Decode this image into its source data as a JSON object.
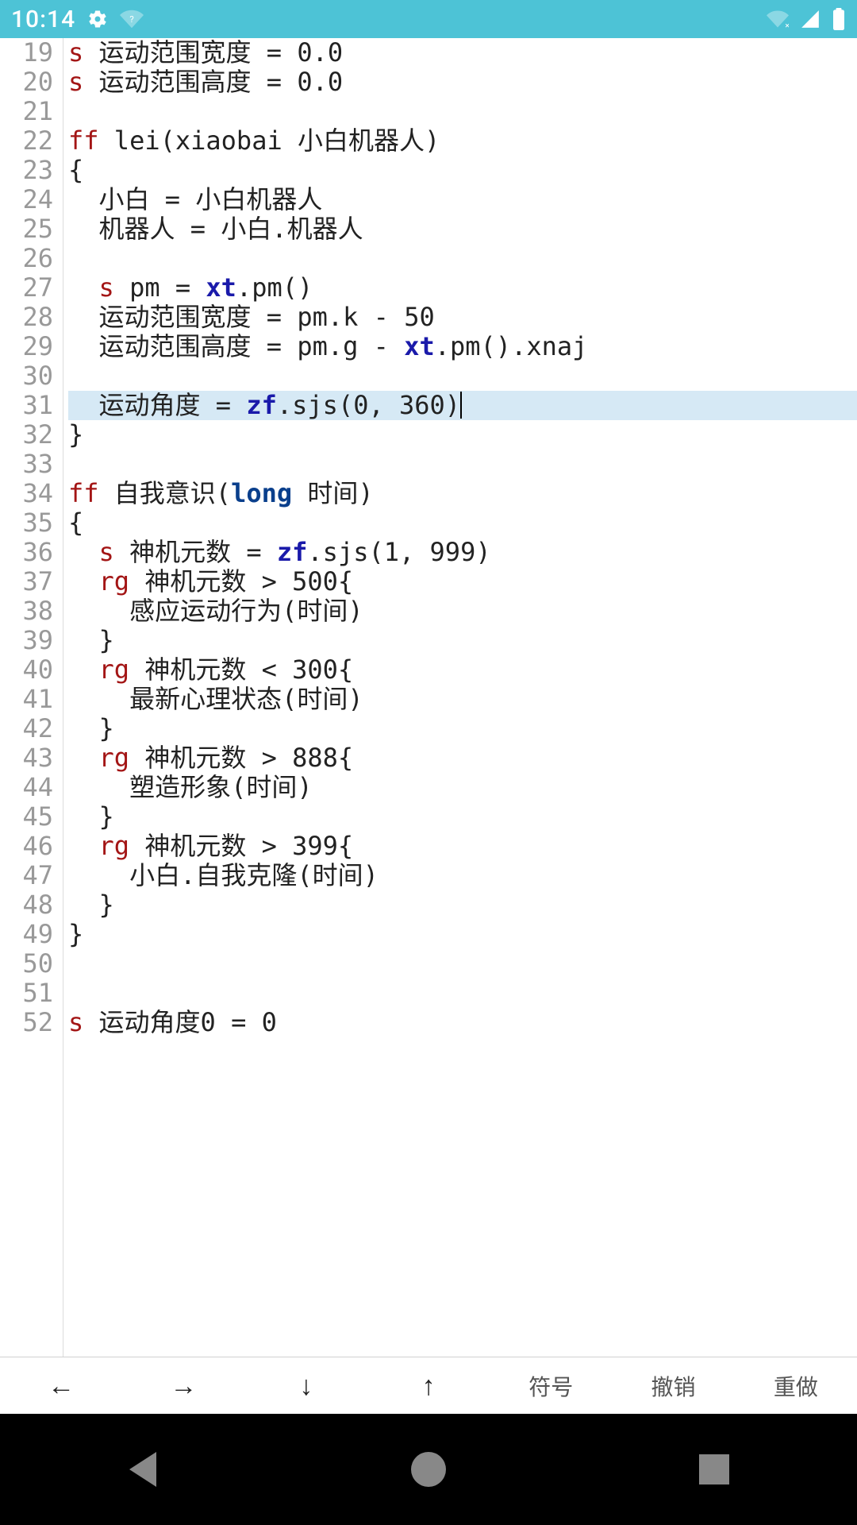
{
  "status": {
    "time": "10:14"
  },
  "toolbar": {
    "left": "←",
    "right": "→",
    "down": "↓",
    "up": "↑",
    "symbol": "符号",
    "undo": "撤销",
    "redo": "重做"
  },
  "code": {
    "first_line_no": 19,
    "highlighted_line_no": 31,
    "lines": [
      {
        "n": 19,
        "tokens": [
          [
            "kw",
            "s"
          ],
          [
            "txt",
            " 运动范围宽度 = 0.0"
          ]
        ]
      },
      {
        "n": 20,
        "tokens": [
          [
            "kw",
            "s"
          ],
          [
            "txt",
            " 运动范围高度 = 0.0"
          ]
        ]
      },
      {
        "n": 21,
        "tokens": []
      },
      {
        "n": 22,
        "tokens": [
          [
            "kw",
            "ff"
          ],
          [
            "txt",
            " lei(xiaobai 小白机器人)"
          ]
        ]
      },
      {
        "n": 23,
        "tokens": [
          [
            "txt",
            "{"
          ]
        ]
      },
      {
        "n": 24,
        "tokens": [
          [
            "txt",
            "  小白 = 小白机器人"
          ]
        ]
      },
      {
        "n": 25,
        "tokens": [
          [
            "txt",
            "  机器人 = 小白.机器人"
          ]
        ]
      },
      {
        "n": 26,
        "tokens": []
      },
      {
        "n": 27,
        "tokens": [
          [
            "txt",
            "  "
          ],
          [
            "kw",
            "s"
          ],
          [
            "txt",
            " pm = "
          ],
          [
            "fn",
            "xt"
          ],
          [
            "txt",
            ".pm()"
          ]
        ]
      },
      {
        "n": 28,
        "tokens": [
          [
            "txt",
            "  运动范围宽度 = pm.k - 50"
          ]
        ]
      },
      {
        "n": 29,
        "tokens": [
          [
            "txt",
            "  运动范围高度 = pm.g - "
          ],
          [
            "fn",
            "xt"
          ],
          [
            "txt",
            ".pm().xnaj"
          ]
        ]
      },
      {
        "n": 30,
        "tokens": []
      },
      {
        "n": 31,
        "tokens": [
          [
            "txt",
            "  运动角度 = "
          ],
          [
            "fn",
            "zf"
          ],
          [
            "txt",
            ".sjs(0, 360)"
          ]
        ]
      },
      {
        "n": 32,
        "tokens": [
          [
            "txt",
            "}"
          ]
        ]
      },
      {
        "n": 33,
        "tokens": []
      },
      {
        "n": 34,
        "tokens": [
          [
            "kw",
            "ff"
          ],
          [
            "txt",
            " 自我意识("
          ],
          [
            "kw2",
            "long"
          ],
          [
            "txt",
            " 时间)"
          ]
        ]
      },
      {
        "n": 35,
        "tokens": [
          [
            "txt",
            "{"
          ]
        ]
      },
      {
        "n": 36,
        "tokens": [
          [
            "txt",
            "  "
          ],
          [
            "kw",
            "s"
          ],
          [
            "txt",
            " 神机元数 = "
          ],
          [
            "fn",
            "zf"
          ],
          [
            "txt",
            ".sjs(1, 999)"
          ]
        ]
      },
      {
        "n": 37,
        "tokens": [
          [
            "txt",
            "  "
          ],
          [
            "kw",
            "rg"
          ],
          [
            "txt",
            " 神机元数 > 500{"
          ]
        ]
      },
      {
        "n": 38,
        "tokens": [
          [
            "txt",
            "    感应运动行为(时间)"
          ]
        ]
      },
      {
        "n": 39,
        "tokens": [
          [
            "txt",
            "  }"
          ]
        ]
      },
      {
        "n": 40,
        "tokens": [
          [
            "txt",
            "  "
          ],
          [
            "kw",
            "rg"
          ],
          [
            "txt",
            " 神机元数 < 300{"
          ]
        ]
      },
      {
        "n": 41,
        "tokens": [
          [
            "txt",
            "    最新心理状态(时间)"
          ]
        ]
      },
      {
        "n": 42,
        "tokens": [
          [
            "txt",
            "  }"
          ]
        ]
      },
      {
        "n": 43,
        "tokens": [
          [
            "txt",
            "  "
          ],
          [
            "kw",
            "rg"
          ],
          [
            "txt",
            " 神机元数 > 888{"
          ]
        ]
      },
      {
        "n": 44,
        "tokens": [
          [
            "txt",
            "    塑造形象(时间)"
          ]
        ]
      },
      {
        "n": 45,
        "tokens": [
          [
            "txt",
            "  }"
          ]
        ]
      },
      {
        "n": 46,
        "tokens": [
          [
            "txt",
            "  "
          ],
          [
            "kw",
            "rg"
          ],
          [
            "txt",
            " 神机元数 > 399{"
          ]
        ]
      },
      {
        "n": 47,
        "tokens": [
          [
            "txt",
            "    小白.自我克隆(时间)"
          ]
        ]
      },
      {
        "n": 48,
        "tokens": [
          [
            "txt",
            "  }"
          ]
        ]
      },
      {
        "n": 49,
        "tokens": [
          [
            "txt",
            "}"
          ]
        ]
      },
      {
        "n": 50,
        "tokens": []
      },
      {
        "n": 51,
        "tokens": []
      },
      {
        "n": 52,
        "tokens": [
          [
            "kw",
            "s"
          ],
          [
            "txt",
            " 运动角度0 = 0"
          ]
        ]
      }
    ]
  }
}
